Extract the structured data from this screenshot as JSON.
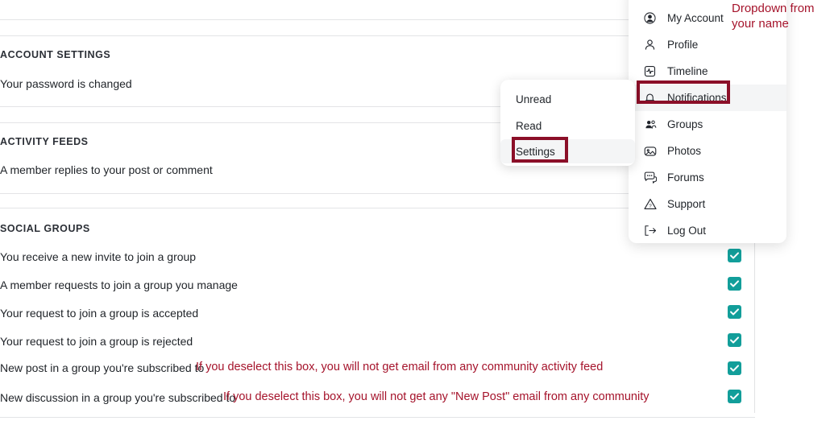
{
  "page": {
    "truncated_top_text": "",
    "sections": [
      {
        "id": "account-settings",
        "title": "ACCOUNT SETTINGS",
        "rows": [
          {
            "label": "Your password is changed",
            "checked": false,
            "note": ""
          }
        ]
      },
      {
        "id": "activity-feeds",
        "title": "ACTIVITY FEEDS",
        "rows": [
          {
            "label": "A member replies to your post or comment",
            "checked": false,
            "note": ""
          }
        ]
      },
      {
        "id": "social-groups",
        "title": "SOCIAL GROUPS",
        "rows": [
          {
            "label": "You receive a new invite to join a group",
            "checked": true,
            "note": ""
          },
          {
            "label": "A member requests to join a group you manage",
            "checked": true,
            "note": ""
          },
          {
            "label": "Your request to join a group is accepted",
            "checked": true,
            "note": ""
          },
          {
            "label": "Your request to join a group is rejected",
            "checked": true,
            "note": ""
          },
          {
            "label": "New post in a group you're subscribed to",
            "checked": true,
            "note": "If you deselect this box, you will not get email from any community activity feed"
          },
          {
            "label": "New discussion in a group you're subscribed to",
            "checked": true,
            "note": "If you deselect this box, you will not get any \"New Post\" email from any community"
          }
        ]
      }
    ]
  },
  "account_menu": {
    "items": [
      {
        "label": "My Account",
        "icon": "user-circle-icon",
        "active": false
      },
      {
        "label": "Profile",
        "icon": "user-icon",
        "active": false
      },
      {
        "label": "Timeline",
        "icon": "activity-icon",
        "active": false
      },
      {
        "label": "Notifications",
        "icon": "bell-icon",
        "active": true
      },
      {
        "label": "Groups",
        "icon": "people-icon",
        "active": false
      },
      {
        "label": "Photos",
        "icon": "photo-icon",
        "active": false
      },
      {
        "label": "Forums",
        "icon": "chat-icon",
        "active": false
      },
      {
        "label": "Support",
        "icon": "warning-icon",
        "active": false
      },
      {
        "label": "Log Out",
        "icon": "logout-icon",
        "active": false
      }
    ]
  },
  "notifications_submenu": {
    "items": [
      {
        "label": "Unread",
        "hovered": false
      },
      {
        "label": "Read",
        "hovered": false
      },
      {
        "label": "Settings",
        "hovered": true
      }
    ]
  },
  "annotations": {
    "dropdown_note_line1": "Dropdown from",
    "dropdown_note_line2": "your name"
  },
  "colors": {
    "checkbox_teal": "#129e9a",
    "annotation_red": "#a5132b",
    "highlight_box": "#8b0f28",
    "divider": "#e3e4e6",
    "hover_bg": "#f4f5f6"
  }
}
